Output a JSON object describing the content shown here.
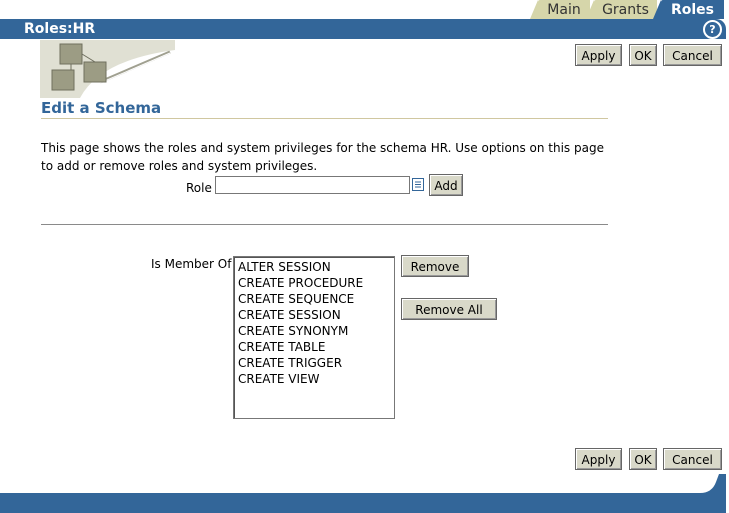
{
  "tabs": [
    {
      "label": "Main"
    },
    {
      "label": "Grants"
    },
    {
      "label": "Roles"
    }
  ],
  "header": {
    "title": "Roles:HR",
    "help_icon": "help-icon"
  },
  "buttons": {
    "apply": "Apply",
    "ok": "OK",
    "cancel": "Cancel"
  },
  "page": {
    "title": "Edit a Schema",
    "description": "This page shows the roles and system privileges for the schema HR. Use options on this page to add or remove roles and system privileges."
  },
  "role": {
    "label": "Role",
    "value": "",
    "add_label": "Add",
    "lov_icon": "list-of-values-icon"
  },
  "membership": {
    "label": "Is Member Of",
    "items": [
      "ALTER SESSION",
      "CREATE PROCEDURE",
      "CREATE SEQUENCE",
      "CREATE SESSION",
      "CREATE SYNONYM",
      "CREATE TABLE",
      "CREATE TRIGGER",
      "CREATE VIEW"
    ],
    "remove_label": "Remove",
    "remove_all_label": "Remove All"
  },
  "colors": {
    "brand": "#336699",
    "tab_inactive": "#d6d6aa",
    "button": "#d9d9c9"
  }
}
